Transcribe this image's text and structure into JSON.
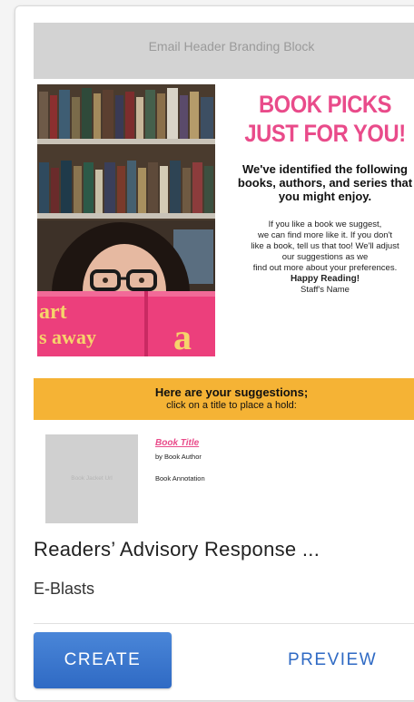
{
  "email_preview": {
    "header_block": "Email Header Branding Block",
    "headline_line1": "BOOK PICKS",
    "headline_line2": "JUST FOR YOU!",
    "subhead": "We've identified the following books, authors, and series that you might enjoy.",
    "body_line1": "If you like a book we suggest,",
    "body_line2": "we can find more like it. If you don't",
    "body_line3": "like a book, tell us that too! We'll adjust",
    "body_line4": "our suggestions as we",
    "body_line5": "find out more about your preferences.",
    "sign_off": "Happy Reading!",
    "signature": "Staff's Name",
    "suggestions_title": "Here are your suggestions;",
    "suggestions_subtitle": "click on a title to place a hold:",
    "book_cover_placeholder": "Book Jacket Url",
    "book_title": "Book Title",
    "book_author": "by Book Author",
    "book_annotation": "Book Annotation",
    "photo_book_text1": "art",
    "photo_book_text2": "s away"
  },
  "card": {
    "title": "Readers’ Advisory Response ...",
    "category": "E-Blasts"
  },
  "actions": {
    "create_label": "CREATE",
    "preview_label": "PREVIEW"
  },
  "colors": {
    "accent_pink": "#e94b8a",
    "suggest_bar": "#f5b335",
    "primary_blue": "#2f6ac4"
  }
}
